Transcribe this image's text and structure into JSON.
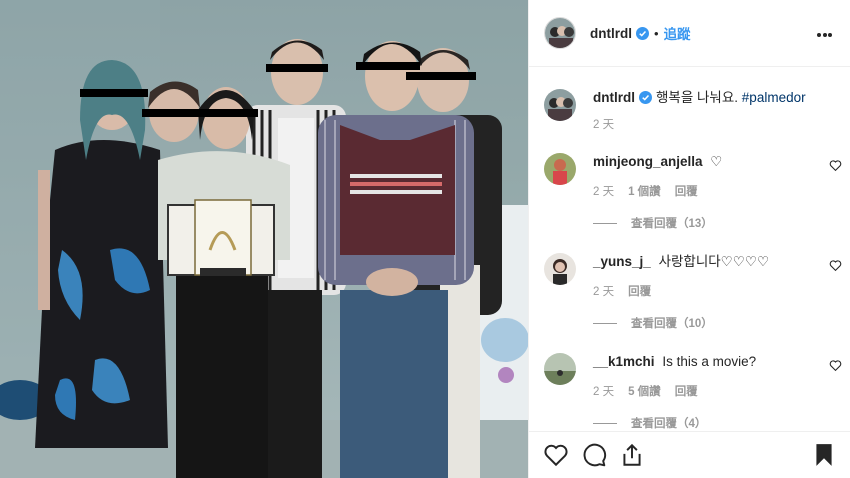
{
  "header": {
    "username": "dntlrdl",
    "separator": "•",
    "follow_label": "追蹤"
  },
  "caption": {
    "username": "dntlrdl",
    "text": "행복을 나눠요.",
    "hashtag": "#palmedor",
    "time": "2 天"
  },
  "comments": [
    {
      "username": "minjeong_anjella",
      "text": "♡",
      "time": "2 天",
      "likes": "1 個讚",
      "reply_label": "回覆",
      "view_replies": "查看回覆（13）"
    },
    {
      "username": "_yuns_j_",
      "text": "사랑합니다♡♡♡♡",
      "time": "2 天",
      "likes": "",
      "reply_label": "回覆",
      "view_replies": "查看回覆（10）"
    },
    {
      "username": "__k1mchi",
      "text": "Is this a movie?",
      "time": "2 天",
      "likes": "5 個讚",
      "reply_label": "回覆",
      "view_replies": "查看回覆（4）"
    }
  ],
  "colors": {
    "accent": "#3897f0",
    "text": "#262626",
    "muted": "#999999",
    "border": "#efefef"
  },
  "icons": [
    "verified-badge-icon",
    "more-options-icon",
    "heart-icon",
    "comment-icon",
    "share-icon",
    "bookmark-icon"
  ]
}
